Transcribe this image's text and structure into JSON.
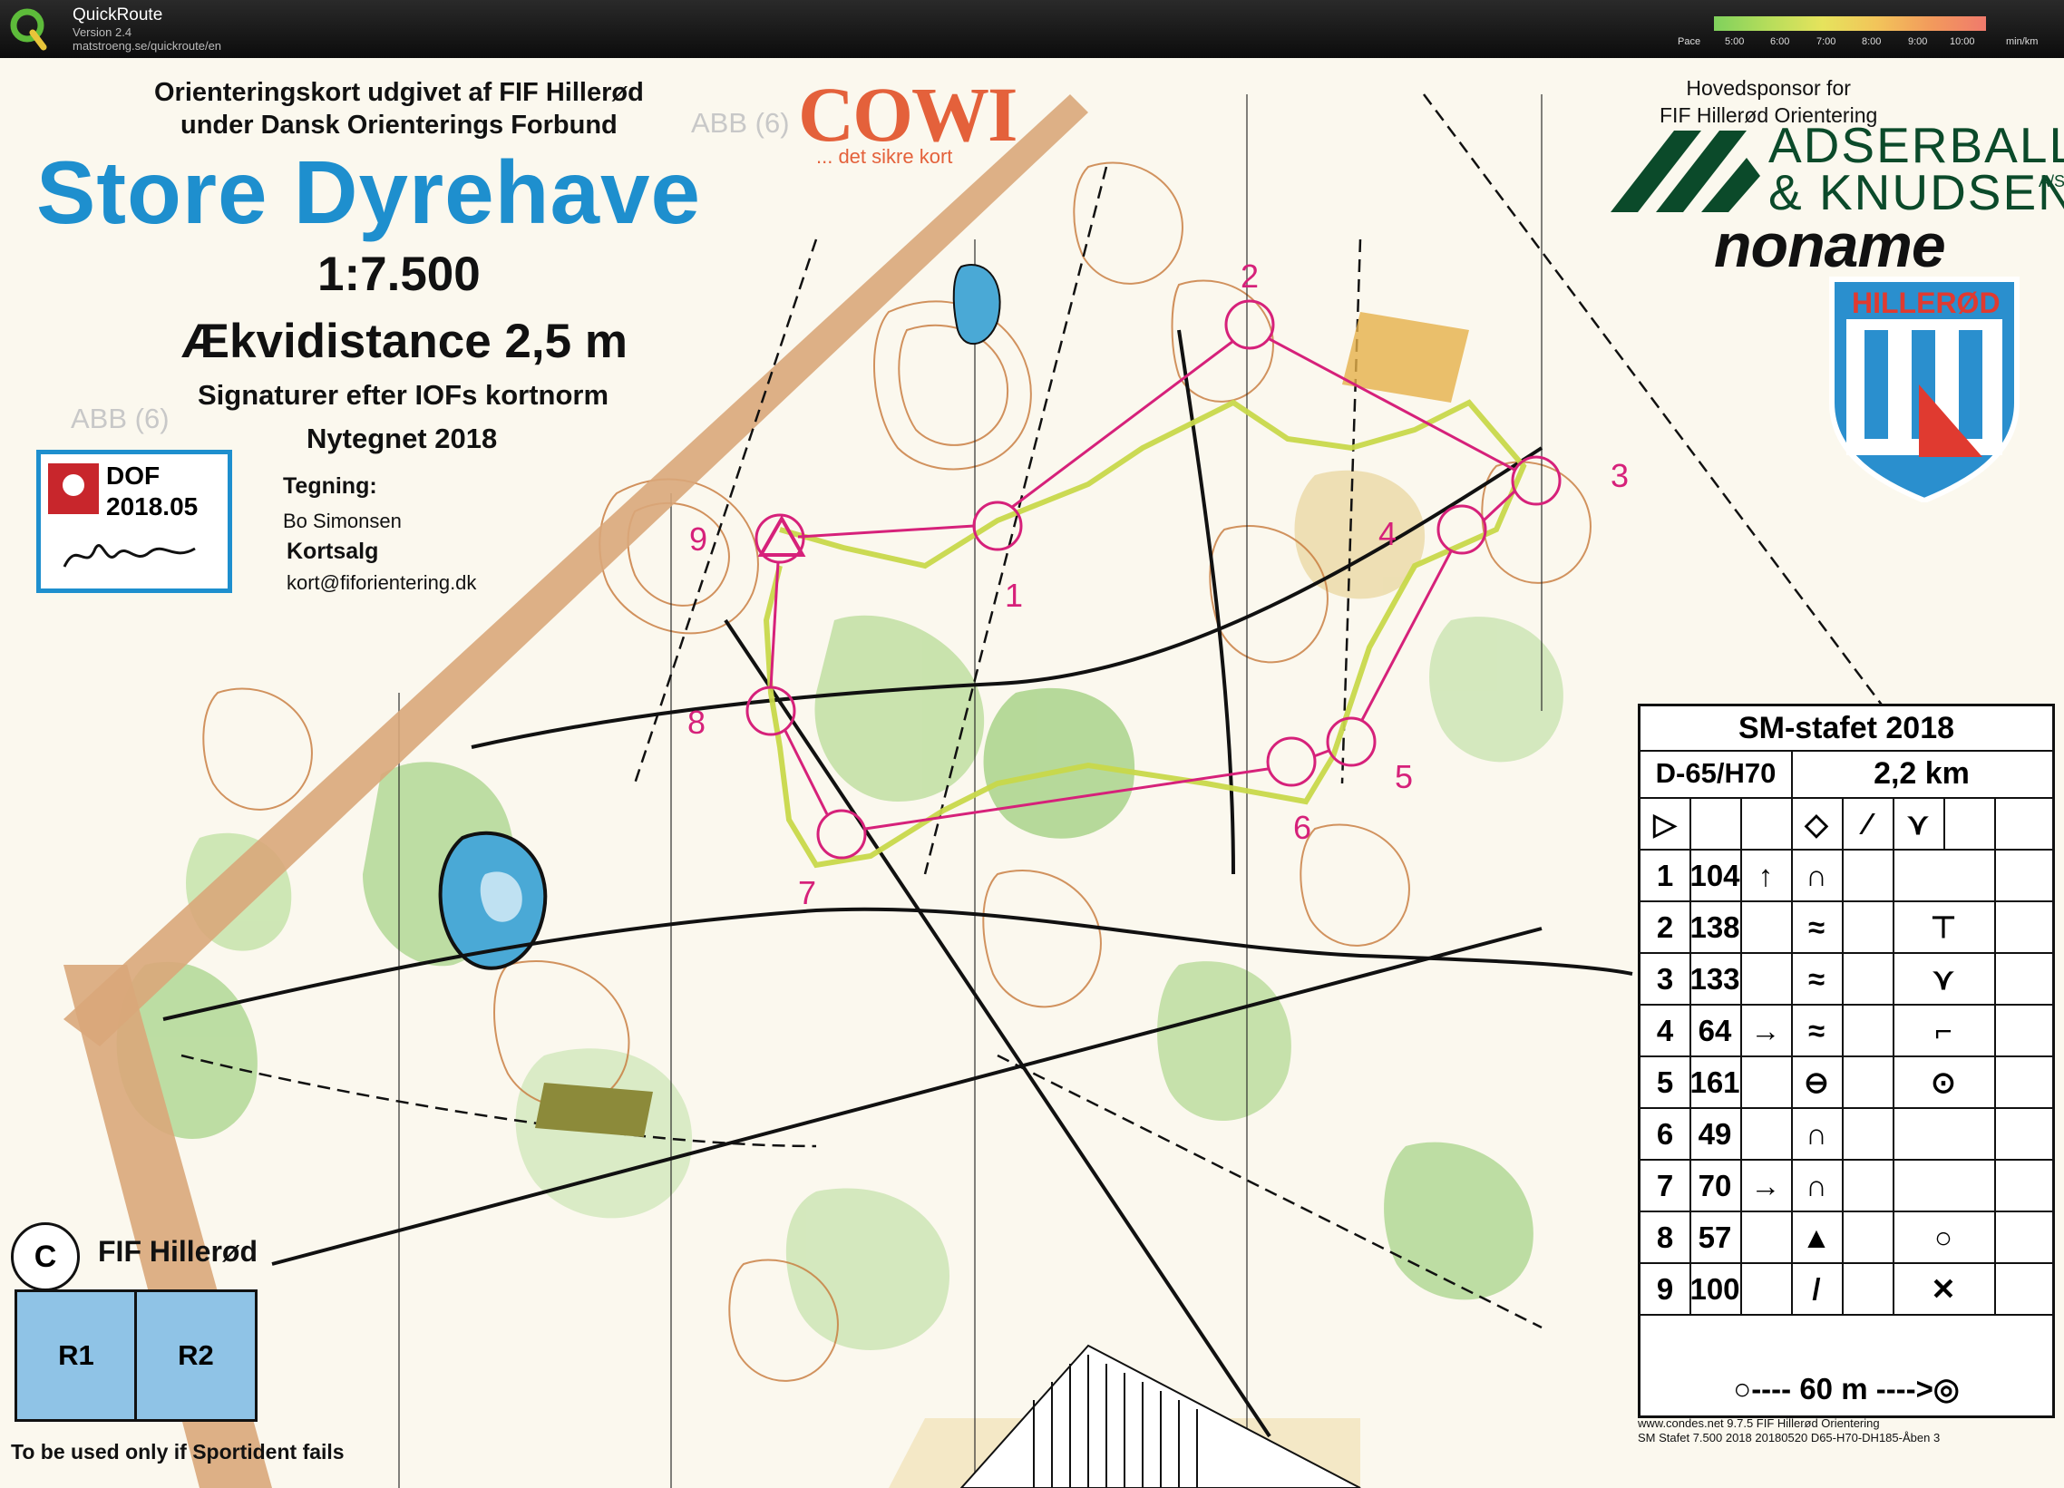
{
  "app": {
    "name": "QuickRoute",
    "version": "Version 2.4",
    "url": "matstroeng.se/quickroute/en"
  },
  "pace_legend": {
    "label": "Pace",
    "ticks": [
      "5:00",
      "6:00",
      "7:00",
      "8:00",
      "9:00",
      "10:00"
    ],
    "unit": "min/km",
    "colors": [
      "#7fd15c",
      "#e6e35c",
      "#f07a6c"
    ]
  },
  "map": {
    "subtitle_line1": "Orienteringskort udgivet af FIF Hillerød",
    "subtitle_line2": "under Dansk Orienterings Forbund",
    "title": "Store Dyrehave",
    "scale": "1:7.500",
    "contour_interval": "Ækvidistance 2,5 m",
    "symbols_note": "Signaturer efter IOFs kortnorm",
    "redrawn": "Nytegnet 2018",
    "drawing_label": "Tegning:",
    "drawing_name": "Bo Simonsen",
    "sales_label": "Kortsalg",
    "sales_email": "kort@fiforientering.dk",
    "abb_label": "ABB (6)",
    "dof_label": "DOF",
    "dof_year": "2018.05",
    "title_color": "#1e8fce",
    "course_color": "#d6217a",
    "route_color": "#c8d84a"
  },
  "sponsors": {
    "cowi_name": "COWI",
    "cowi_tagline": "... det sikre kort",
    "main_label_line1": "Hovedsponsor for",
    "main_label_line2": "FIF Hillerød Orientering",
    "main_name_line1": "ADSERBALLE",
    "main_name_line2": "& KNUDSEN",
    "main_suffix": "A/S",
    "noname": "noname",
    "club_crest": "HILLERØD"
  },
  "controls_on_map": [
    "1",
    "2",
    "3",
    "4",
    "5",
    "6",
    "7",
    "8",
    "9"
  ],
  "control_descriptions": {
    "title": "SM-stafet 2018",
    "class": "D-65/H70",
    "length": "2,2 km",
    "start_symbols": [
      "start-triangle-icon",
      "diamond-icon",
      "slash-icon",
      "fork-icon"
    ],
    "rows": [
      {
        "num": "1",
        "code": "104",
        "dir": "↑",
        "feature": "∩",
        "extra": ""
      },
      {
        "num": "2",
        "code": "138",
        "dir": "",
        "feature": "≈",
        "extra": "⊤"
      },
      {
        "num": "3",
        "code": "133",
        "dir": "",
        "feature": "≈",
        "extra": "⋎"
      },
      {
        "num": "4",
        "code": "64",
        "dir": "→",
        "feature": "≈",
        "extra": "⌐"
      },
      {
        "num": "5",
        "code": "161",
        "dir": "",
        "feature": "⊖",
        "extra": "⊙"
      },
      {
        "num": "6",
        "code": "49",
        "dir": "",
        "feature": "∩",
        "extra": ""
      },
      {
        "num": "7",
        "code": "70",
        "dir": "→",
        "feature": "∩",
        "extra": ""
      },
      {
        "num": "8",
        "code": "57",
        "dir": "",
        "feature": "▲",
        "extra": "○"
      },
      {
        "num": "9",
        "code": "100",
        "dir": "",
        "feature": "/",
        "extra": "✕"
      }
    ],
    "finish": "○---- 60 m ---->◎"
  },
  "relay": {
    "symbol": "C",
    "club": "FIF Hillerød",
    "legs": [
      "R1",
      "R2"
    ],
    "note": "To be used only if Sportident fails"
  },
  "print_info": {
    "line1": "www.condes.net 9.7.5 FIF Hillerød Orientering",
    "line2": "SM Stafet 7.500 2018 20180520 D65-H70-DH185-Åben 3"
  }
}
